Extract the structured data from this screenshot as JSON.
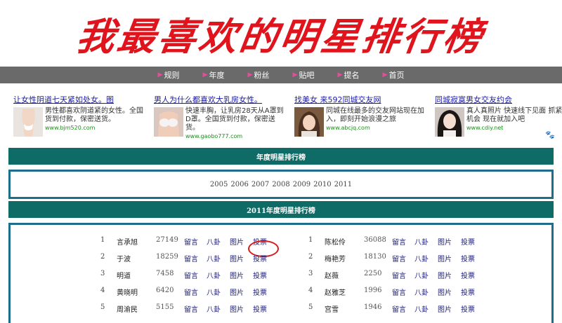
{
  "banner": {
    "title": "我最喜欢的明星排行榜"
  },
  "nav": {
    "items": [
      "规则",
      "年度",
      "粉丝",
      "贴吧",
      "提名",
      "首页"
    ]
  },
  "ads": [
    {
      "title": "让女性阴道七天紧如处女。图",
      "text": "男性都喜欢阴道紧的女性。全国货到付款，保密送货。",
      "url": "www.bjm520.com",
      "img": "woman-body"
    },
    {
      "title": "男人为什么都喜欢大乳房女性。",
      "text": "快速丰胸，让乳房28天从A罩到D罩。全国货到付款，保密送货。",
      "url": "www.gaobo777.com",
      "img": "bra-model"
    },
    {
      "title": "找美女 来592同城交友网",
      "text": "同城在线最多的交友网站现在加入，即刻开始浪漫之旅",
      "url": "www.abcjq.com",
      "img": "girl-portrait"
    },
    {
      "title": "同城寂寞男女交友约会",
      "text": "真人真照片 快速线下见面 抓紧机会 现在就加入吧",
      "url": "www.cdiy.net",
      "img": "girl-portrait-2"
    }
  ],
  "year_section": {
    "title": "年度明星排行榜",
    "years": [
      "2005",
      "2006",
      "2007",
      "2008",
      "2009",
      "2010",
      "2011"
    ]
  },
  "ranking_section": {
    "title": "2011年度明星排行榜",
    "link_labels": [
      "留言",
      "八卦",
      "图片",
      "投票"
    ],
    "left": [
      {
        "rank": "1",
        "name": "言承旭",
        "score": "27149"
      },
      {
        "rank": "2",
        "name": "于波",
        "score": "18259"
      },
      {
        "rank": "3",
        "name": "明道",
        "score": "7458"
      },
      {
        "rank": "4",
        "name": "黄晓明",
        "score": "6420"
      },
      {
        "rank": "5",
        "name": "周渝民",
        "score": "5155"
      }
    ],
    "right": [
      {
        "rank": "1",
        "name": "陈松伶",
        "score": "36088"
      },
      {
        "rank": "2",
        "name": "梅艳芳",
        "score": "18130"
      },
      {
        "rank": "3",
        "name": "赵薇",
        "score": "2250"
      },
      {
        "rank": "4",
        "name": "赵雅芝",
        "score": "1996"
      },
      {
        "rank": "5",
        "name": "宫雪",
        "score": "1946"
      }
    ]
  },
  "colors": {
    "banner": "#e0141c",
    "nav": "#6a6a6a",
    "bar": "#0e6b66",
    "box_border": "#1d6d8c",
    "highlight_circle": "#d41a1a"
  }
}
